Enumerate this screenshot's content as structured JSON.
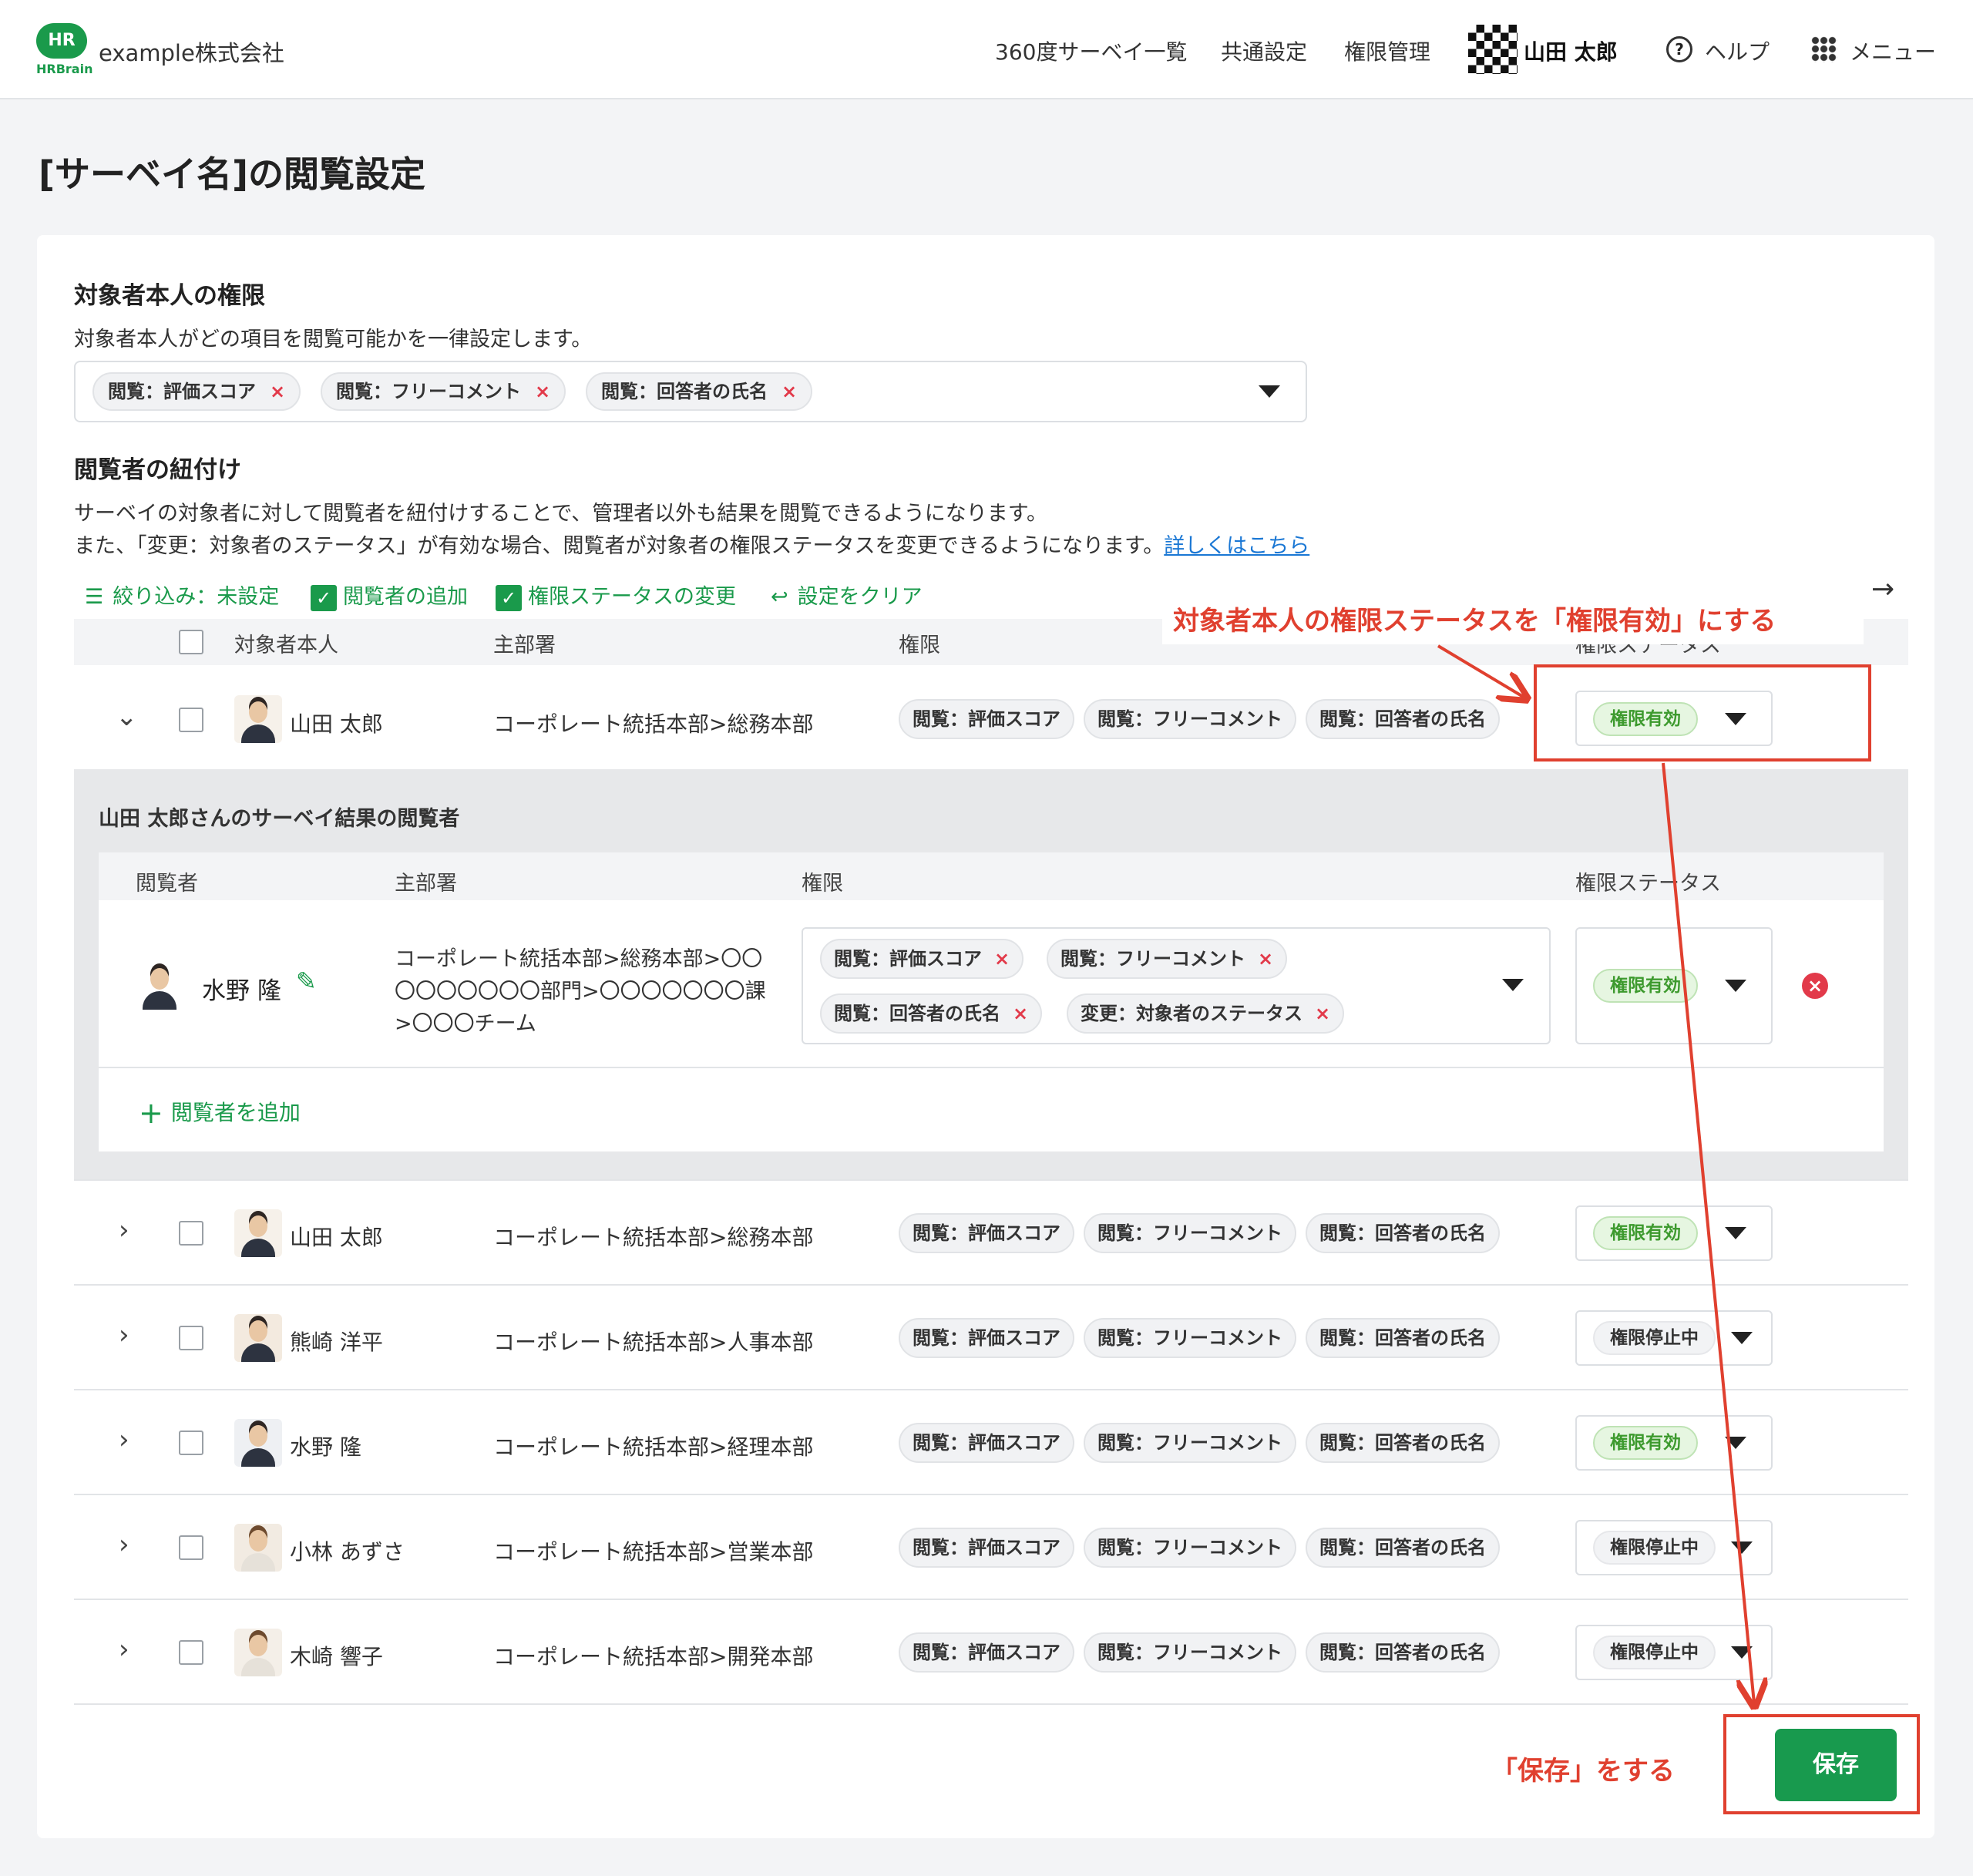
{
  "header": {
    "logo_text": "HR",
    "logo_sub": "HRBrain",
    "company": "example株式会社",
    "nav": [
      "360度サーベイ一覧",
      "共通設定",
      "権限管理"
    ],
    "user_name": "山田 太郎",
    "help_label": "ヘルプ",
    "menu_label": "メニュー"
  },
  "page": {
    "title": "[サーベイ名]の閲覧設定"
  },
  "self_permission": {
    "heading": "対象者本人の権限",
    "description": "対象者本人がどの項目を閲覧可能かを一律設定します。",
    "tags": [
      "閲覧：評価スコア",
      "閲覧：フリーコメント",
      "閲覧：回答者の氏名"
    ],
    "remove_mark": "×"
  },
  "viewer_link": {
    "heading": "閲覧者の紐付け",
    "description1": "サーベイの対象者に対して閲覧者を紐付けすることで、管理者以外も結果を閲覧できるようになります。",
    "description2": "また、「変更：対象者のステータス」が有効な場合、閲覧者が対象者の権限ステータスを変更できるようになります。",
    "more_link": "詳しくはこちら"
  },
  "toolbar": {
    "filter": "絞り込み：未設定",
    "add_viewer": "閲覧者の追加",
    "change_status": "権限ステータスの変更",
    "clear": "設定をクリア"
  },
  "table": {
    "headers": [
      "対象者本人",
      "主部署",
      "権限",
      "権限ステータス"
    ],
    "rows": [
      {
        "name": "山田 太郎",
        "dept": "コーポレート統括本部>総務本部",
        "perms": [
          "閲覧：評価スコア",
          "閲覧：フリーコメント",
          "閲覧：回答者の氏名"
        ],
        "status": "権限有効",
        "expanded": true
      },
      {
        "name": "山田 太郎",
        "dept": "コーポレート統括本部>総務本部",
        "perms": [
          "閲覧：評価スコア",
          "閲覧：フリーコメント",
          "閲覧：回答者の氏名"
        ],
        "status": "権限有効"
      },
      {
        "name": "熊崎 洋平",
        "dept": "コーポレート統括本部>人事本部",
        "perms": [
          "閲覧：評価スコア",
          "閲覧：フリーコメント",
          "閲覧：回答者の氏名"
        ],
        "status": "権限停止中"
      },
      {
        "name": "水野 隆",
        "dept": "コーポレート統括本部>経理本部",
        "perms": [
          "閲覧：評価スコア",
          "閲覧：フリーコメント",
          "閲覧：回答者の氏名"
        ],
        "status": "権限有効"
      },
      {
        "name": "小林 あずさ",
        "dept": "コーポレート統括本部>営業本部",
        "perms": [
          "閲覧：評価スコア",
          "閲覧：フリーコメント",
          "閲覧：回答者の氏名"
        ],
        "status": "権限停止中"
      },
      {
        "name": "木崎 響子",
        "dept": "コーポレート統括本部>開発本部",
        "perms": [
          "閲覧：評価スコア",
          "閲覧：フリーコメント",
          "閲覧：回答者の氏名"
        ],
        "status": "権限停止中"
      }
    ]
  },
  "sub_panel": {
    "title": "山田 太郎さんのサーベイ結果の閲覧者",
    "headers": [
      "閲覧者",
      "主部署",
      "権限",
      "権限ステータス"
    ],
    "viewer": {
      "name": "水野 隆",
      "dept_lines": [
        "コーポレート統括本部>総務本部>〇〇",
        "〇〇〇〇〇〇〇部門>〇〇〇〇〇〇〇課",
        ">〇〇〇チーム"
      ],
      "perms": [
        "閲覧：評価スコア",
        "閲覧：フリーコメント",
        "閲覧：回答者の氏名",
        "変更：対象者のステータス"
      ],
      "status": "権限有効"
    },
    "add_viewer": "閲覧者を追加"
  },
  "annotations": {
    "status_note": "対象者本人の権限ステータスを「権限有効」にする",
    "save_note": "「保存」をする"
  },
  "save_label": "保存",
  "colors": {
    "brand": "#1a9a4b",
    "annotation": "#e0402f",
    "active_status": "#3d9a2e"
  },
  "icons": {
    "edit": "pencil-icon",
    "delete": "remove-circle-icon",
    "next": "arrow-right-icon"
  }
}
